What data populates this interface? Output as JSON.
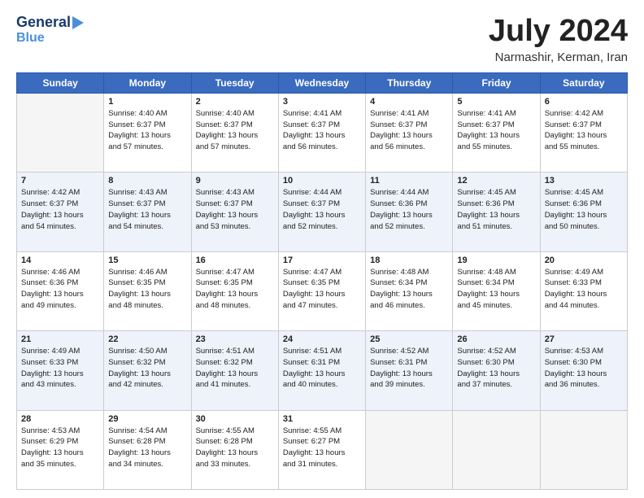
{
  "header": {
    "logo_line1": "General",
    "logo_line2": "Blue",
    "month_year": "July 2024",
    "location": "Narmashir, Kerman, Iran"
  },
  "days_of_week": [
    "Sunday",
    "Monday",
    "Tuesday",
    "Wednesday",
    "Thursday",
    "Friday",
    "Saturday"
  ],
  "weeks": [
    [
      {
        "day": null,
        "info": null
      },
      {
        "day": "1",
        "info": "Sunrise: 4:40 AM\nSunset: 6:37 PM\nDaylight: 13 hours\nand 57 minutes."
      },
      {
        "day": "2",
        "info": "Sunrise: 4:40 AM\nSunset: 6:37 PM\nDaylight: 13 hours\nand 57 minutes."
      },
      {
        "day": "3",
        "info": "Sunrise: 4:41 AM\nSunset: 6:37 PM\nDaylight: 13 hours\nand 56 minutes."
      },
      {
        "day": "4",
        "info": "Sunrise: 4:41 AM\nSunset: 6:37 PM\nDaylight: 13 hours\nand 56 minutes."
      },
      {
        "day": "5",
        "info": "Sunrise: 4:41 AM\nSunset: 6:37 PM\nDaylight: 13 hours\nand 55 minutes."
      },
      {
        "day": "6",
        "info": "Sunrise: 4:42 AM\nSunset: 6:37 PM\nDaylight: 13 hours\nand 55 minutes."
      }
    ],
    [
      {
        "day": "7",
        "info": "Sunrise: 4:42 AM\nSunset: 6:37 PM\nDaylight: 13 hours\nand 54 minutes."
      },
      {
        "day": "8",
        "info": "Sunrise: 4:43 AM\nSunset: 6:37 PM\nDaylight: 13 hours\nand 54 minutes."
      },
      {
        "day": "9",
        "info": "Sunrise: 4:43 AM\nSunset: 6:37 PM\nDaylight: 13 hours\nand 53 minutes."
      },
      {
        "day": "10",
        "info": "Sunrise: 4:44 AM\nSunset: 6:37 PM\nDaylight: 13 hours\nand 52 minutes."
      },
      {
        "day": "11",
        "info": "Sunrise: 4:44 AM\nSunset: 6:36 PM\nDaylight: 13 hours\nand 52 minutes."
      },
      {
        "day": "12",
        "info": "Sunrise: 4:45 AM\nSunset: 6:36 PM\nDaylight: 13 hours\nand 51 minutes."
      },
      {
        "day": "13",
        "info": "Sunrise: 4:45 AM\nSunset: 6:36 PM\nDaylight: 13 hours\nand 50 minutes."
      }
    ],
    [
      {
        "day": "14",
        "info": "Sunrise: 4:46 AM\nSunset: 6:36 PM\nDaylight: 13 hours\nand 49 minutes."
      },
      {
        "day": "15",
        "info": "Sunrise: 4:46 AM\nSunset: 6:35 PM\nDaylight: 13 hours\nand 48 minutes."
      },
      {
        "day": "16",
        "info": "Sunrise: 4:47 AM\nSunset: 6:35 PM\nDaylight: 13 hours\nand 48 minutes."
      },
      {
        "day": "17",
        "info": "Sunrise: 4:47 AM\nSunset: 6:35 PM\nDaylight: 13 hours\nand 47 minutes."
      },
      {
        "day": "18",
        "info": "Sunrise: 4:48 AM\nSunset: 6:34 PM\nDaylight: 13 hours\nand 46 minutes."
      },
      {
        "day": "19",
        "info": "Sunrise: 4:48 AM\nSunset: 6:34 PM\nDaylight: 13 hours\nand 45 minutes."
      },
      {
        "day": "20",
        "info": "Sunrise: 4:49 AM\nSunset: 6:33 PM\nDaylight: 13 hours\nand 44 minutes."
      }
    ],
    [
      {
        "day": "21",
        "info": "Sunrise: 4:49 AM\nSunset: 6:33 PM\nDaylight: 13 hours\nand 43 minutes."
      },
      {
        "day": "22",
        "info": "Sunrise: 4:50 AM\nSunset: 6:32 PM\nDaylight: 13 hours\nand 42 minutes."
      },
      {
        "day": "23",
        "info": "Sunrise: 4:51 AM\nSunset: 6:32 PM\nDaylight: 13 hours\nand 41 minutes."
      },
      {
        "day": "24",
        "info": "Sunrise: 4:51 AM\nSunset: 6:31 PM\nDaylight: 13 hours\nand 40 minutes."
      },
      {
        "day": "25",
        "info": "Sunrise: 4:52 AM\nSunset: 6:31 PM\nDaylight: 13 hours\nand 39 minutes."
      },
      {
        "day": "26",
        "info": "Sunrise: 4:52 AM\nSunset: 6:30 PM\nDaylight: 13 hours\nand 37 minutes."
      },
      {
        "day": "27",
        "info": "Sunrise: 4:53 AM\nSunset: 6:30 PM\nDaylight: 13 hours\nand 36 minutes."
      }
    ],
    [
      {
        "day": "28",
        "info": "Sunrise: 4:53 AM\nSunset: 6:29 PM\nDaylight: 13 hours\nand 35 minutes."
      },
      {
        "day": "29",
        "info": "Sunrise: 4:54 AM\nSunset: 6:28 PM\nDaylight: 13 hours\nand 34 minutes."
      },
      {
        "day": "30",
        "info": "Sunrise: 4:55 AM\nSunset: 6:28 PM\nDaylight: 13 hours\nand 33 minutes."
      },
      {
        "day": "31",
        "info": "Sunrise: 4:55 AM\nSunset: 6:27 PM\nDaylight: 13 hours\nand 31 minutes."
      },
      {
        "day": null,
        "info": null
      },
      {
        "day": null,
        "info": null
      },
      {
        "day": null,
        "info": null
      }
    ]
  ]
}
